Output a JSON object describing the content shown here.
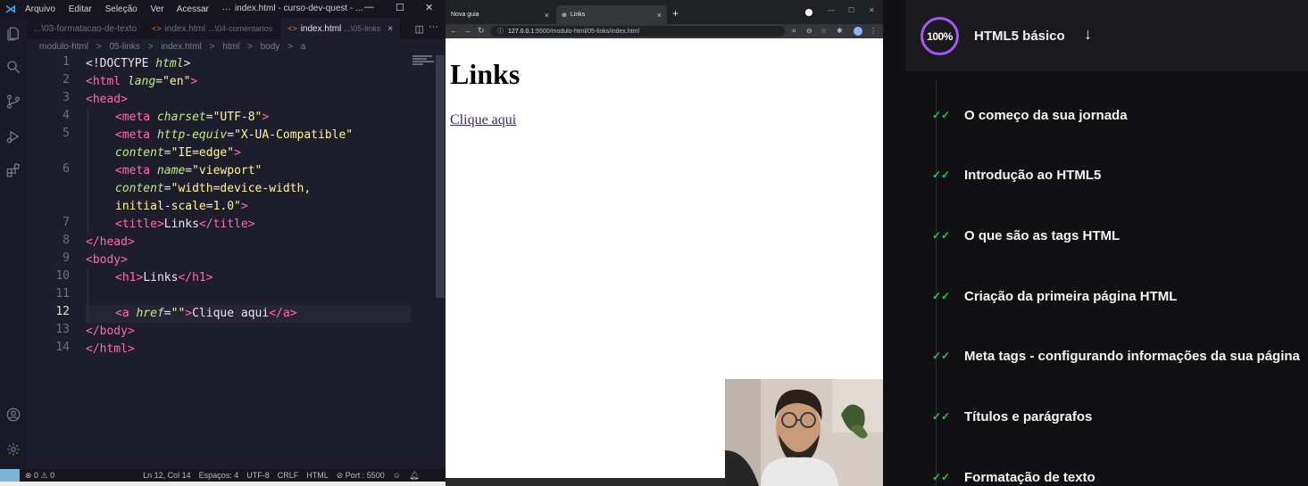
{
  "vscode": {
    "menu": [
      "Arquivo",
      "Editar",
      "Seleção",
      "Ver",
      "Acessar",
      "···"
    ],
    "window_title": "index.html - curso-dev-quest - ...",
    "tabs": [
      {
        "label": "...\\03-formatacao-de-texto",
        "path": ""
      },
      {
        "label": "index.html",
        "path": "...\\04-comentarios"
      },
      {
        "label": "index.html",
        "path": "...\\05-links",
        "close": "×"
      }
    ],
    "breadcrumb": [
      "modulo-html",
      ">",
      "05-links",
      ">",
      "index.html",
      ">",
      "html",
      ">",
      "body",
      ">",
      "a"
    ],
    "line_numbers": [
      "1",
      "2",
      "3",
      "4",
      "5",
      "",
      "6",
      "",
      "",
      "7",
      "8",
      "9",
      "10",
      "11",
      "12",
      "13",
      "14"
    ],
    "code": {
      "l1_a": "<!DOCTYPE ",
      "l1_b": "html",
      "l1_c": ">",
      "l2_a": "<html ",
      "l2_b": "lang",
      "l2_c": "=",
      "l2_d": "\"en\"",
      "l2_e": ">",
      "l3": "<head>",
      "l4_a": "<meta ",
      "l4_b": "charset",
      "l4_c": "=",
      "l4_d": "\"UTF-8\"",
      "l4_e": ">",
      "l5_a": "<meta ",
      "l5_b": "http-equiv",
      "l5_c": "=",
      "l5_d": "\"X-UA-Compatible\"",
      "l5w_b": "content",
      "l5w_c": "=",
      "l5w_d": "\"IE=edge\"",
      "l5w_e": ">",
      "l6_a": "<meta ",
      "l6_b": "name",
      "l6_c": "=",
      "l6_d": "\"viewport\"",
      "l6w_b": "content",
      "l6w_c": "=",
      "l6w_d": "\"width=device-width,",
      "l6w2_d": "initial-scale=1.0\"",
      "l6w2_e": ">",
      "l7_a": "<title>",
      "l7_b": "Links",
      "l7_c": "</title>",
      "l8": "</head>",
      "l9": "<body>",
      "l10_a": "<h1>",
      "l10_b": "Links",
      "l10_c": "</h1>",
      "l12_a": "<a ",
      "l12_b": "href",
      "l12_c": "=",
      "l12_d": "\"\"",
      "l12_e": ">",
      "l12_f": "Clique aqui",
      "l12_g": "</a>",
      "l13": "</body>",
      "l14": "</html>"
    },
    "status": {
      "errors": "⊗ 0 ⚠ 0",
      "position": "Ln 12, Col 14",
      "spaces": "Espaços: 4",
      "encoding": "UTF-8",
      "eol": "CRLF",
      "language": "HTML",
      "port": "⊘ Port : 5500"
    }
  },
  "browser": {
    "tabs": [
      {
        "label": "Nova guia",
        "close": "×"
      },
      {
        "label": "Links",
        "close": "×"
      }
    ],
    "new_tab": "+",
    "url_host": "127.0.0.1",
    "url_rest": ":5500/modulo-html/05-links/index.html",
    "page_heading": "Links",
    "page_link": "Clique aqui"
  },
  "course": {
    "progress": "100%",
    "progress_fraction": 1.0,
    "accent_color": "#a855f7",
    "check_color": "#22c55e",
    "title": "HTML5 básico",
    "lessons": [
      "O começo da sua jornada",
      "Introdução ao HTML5",
      "O que são as tags HTML",
      "Criação da primeira página HTML",
      "Meta tags - configurando informações da sua página",
      "Títulos e parágrafos",
      "Formatação de texto"
    ]
  }
}
